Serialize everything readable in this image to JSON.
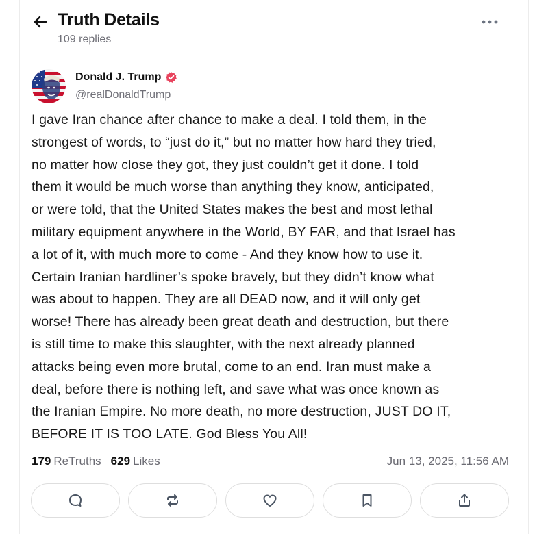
{
  "header": {
    "title": "Truth Details",
    "replies": "109 replies",
    "back_icon": "arrow-left-icon",
    "more_icon": "more-horizontal-icon"
  },
  "author": {
    "name": "Donald J. Trump",
    "handle": "@realDonaldTrump",
    "verified": true,
    "verified_color": "#e8445e"
  },
  "post": {
    "lines": [
      "I gave Iran chance after chance to make a deal. I told them, in the",
      "strongest of words, to “just do it,” but no matter how hard they tried,",
      "no matter how close they got, they just couldn’t get it done. I told",
      "them it would be much worse than anything they know, anticipated,",
      "or were told, that the United States makes the best and most lethal",
      "military equipment anywhere in the World, BY FAR, and that Israel has",
      "a lot of it, with much more to come - And they know how to use it.",
      "Certain Iranian hardliner’s spoke bravely, but they didn’t know what",
      "was about to happen. They are all DEAD now, and it will only get",
      "worse! There has already been great death and destruction, but there",
      "is still time to make this slaughter, with the next already planned",
      "attacks being even more brutal, come to an end. Iran must make a",
      "deal, before there is nothing left, and save what was once known as",
      "the Iranian Empire. No more death, no more destruction, JUST DO IT,",
      "BEFORE IT IS TOO LATE. God Bless You All!"
    ]
  },
  "stats": {
    "retruths_count": "179",
    "retruths_label": "ReTruths",
    "likes_count": "629",
    "likes_label": "Likes",
    "timestamp": "Jun 13, 2025, 11:56 AM"
  },
  "actions": [
    {
      "name": "reply",
      "icon": "comment-icon"
    },
    {
      "name": "retruth",
      "icon": "repost-icon"
    },
    {
      "name": "like",
      "icon": "heart-icon"
    },
    {
      "name": "bookmark",
      "icon": "bookmark-icon"
    },
    {
      "name": "share",
      "icon": "share-icon"
    }
  ],
  "colors": {
    "text": "#111111",
    "muted": "#707078",
    "border": "#dedede",
    "icon": "#4b5563"
  }
}
